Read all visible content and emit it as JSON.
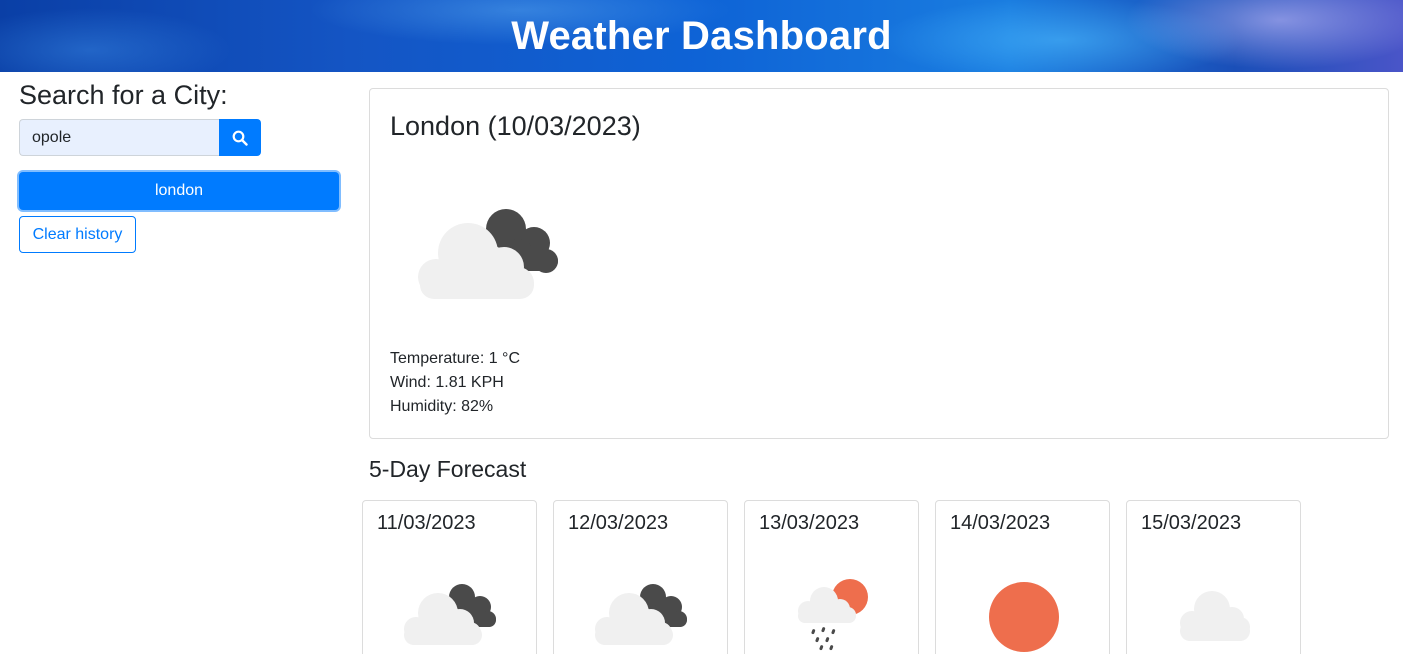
{
  "header": {
    "title": "Weather Dashboard"
  },
  "search": {
    "heading": "Search for a City:",
    "value": "opole",
    "button_icon": "search-icon"
  },
  "history": [
    "london"
  ],
  "clear_label": "Clear history",
  "today": {
    "title": "London (10/03/2023)",
    "icon": "broken-clouds-icon",
    "temperature": "Temperature: 1 °C",
    "wind": "Wind: 1.81 KPH",
    "humidity": "Humidity: 82%"
  },
  "forecast": {
    "title": "5-Day Forecast",
    "days": [
      {
        "date": "11/03/2023",
        "icon": "broken-clouds-icon"
      },
      {
        "date": "12/03/2023",
        "icon": "broken-clouds-icon"
      },
      {
        "date": "13/03/2023",
        "icon": "rain-sun-icon"
      },
      {
        "date": "14/03/2023",
        "icon": "clear-sun-icon"
      },
      {
        "date": "15/03/2023",
        "icon": "cloud-icon"
      }
    ]
  },
  "colors": {
    "primary": "#007bff",
    "sun": "#ee6e4d",
    "cloud_light": "#f0f0f0",
    "cloud_dark": "#4a4a4a"
  }
}
